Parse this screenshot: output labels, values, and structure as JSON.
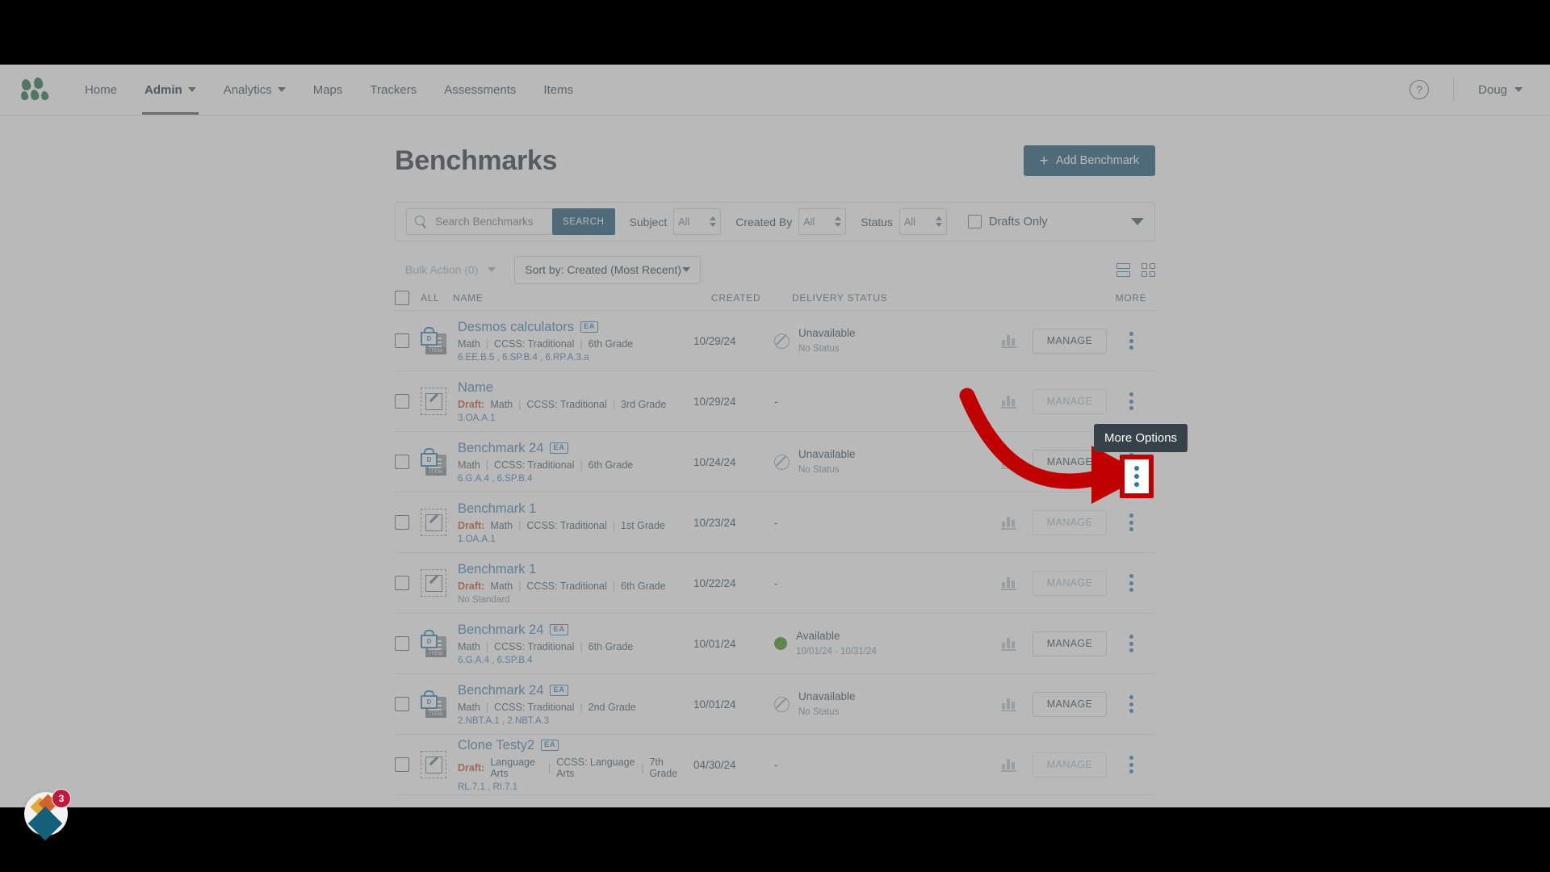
{
  "nav": {
    "logo_icon": "three-leaf-logo",
    "items": [
      {
        "label": "Home",
        "has_caret": false,
        "active": false
      },
      {
        "label": "Admin",
        "has_caret": true,
        "active": true
      },
      {
        "label": "Analytics",
        "has_caret": true,
        "active": false
      },
      {
        "label": "Maps",
        "has_caret": false,
        "active": false
      },
      {
        "label": "Trackers",
        "has_caret": false,
        "active": false
      },
      {
        "label": "Assessments",
        "has_caret": false,
        "active": false
      },
      {
        "label": "Items",
        "has_caret": false,
        "active": false
      }
    ],
    "help_icon": "question-mark-circle-icon",
    "user_label": "Doug"
  },
  "header": {
    "title": "Benchmarks",
    "add_button": "Add Benchmark",
    "add_button_icon": "plus-icon",
    "add_button_color": "#145374"
  },
  "filters": {
    "search_placeholder": "Search Benchmarks",
    "search_value": "",
    "search_icon": "search-icon",
    "search_button": "SEARCH",
    "subject_label": "Subject",
    "subject_value": "All",
    "created_by_label": "Created By",
    "created_by_value": "All",
    "status_label": "Status",
    "status_value": "All",
    "drafts_only_label": "Drafts Only",
    "drafts_only_checked": false,
    "expand_icon": "chevron-down-icon"
  },
  "actions": {
    "bulk_action_label": "Bulk Action (0)",
    "sort_label": "Sort by: Created (Most Recent)",
    "list_view_icon": "list-view-icon",
    "grid_view_icon": "grid-view-icon",
    "active_view": "list"
  },
  "table": {
    "headers": {
      "all": "ALL",
      "name": "NAME",
      "created": "CREATED",
      "delivery_status": "DELIVERY STATUS",
      "more": "MORE"
    },
    "manage_label": "MANAGE",
    "rows": [
      {
        "icon": "locked-item-icon",
        "title": "Desmos calculators",
        "badge": "EA",
        "draft": false,
        "draft_label": "",
        "subject": "Math",
        "framework": "CCSS: Traditional",
        "grade": "6th Grade",
        "standards": "6.EE.B.5 , 6.SP.B.4 , 6.RP.A.3.a",
        "created": "10/29/24",
        "status": "Unavailable",
        "status_sub": "No Status",
        "status_type": "unavailable",
        "manage_enabled": true
      },
      {
        "icon": "draft-pencil-icon",
        "title": "Name",
        "badge": "",
        "draft": true,
        "draft_label": "Draft:",
        "subject": "Math",
        "framework": "CCSS: Traditional",
        "grade": "3rd Grade",
        "standards": "3.OA.A.1",
        "created": "10/29/24",
        "status": "-",
        "status_sub": "",
        "status_type": "none",
        "manage_enabled": false
      },
      {
        "icon": "locked-item-icon",
        "title": "Benchmark 24",
        "badge": "EA",
        "draft": false,
        "draft_label": "",
        "subject": "Math",
        "framework": "CCSS: Traditional",
        "grade": "6th Grade",
        "standards": "6.G.A.4 , 6.SP.B.4",
        "created": "10/24/24",
        "status": "Unavailable",
        "status_sub": "No Status",
        "status_type": "unavailable",
        "manage_enabled": true
      },
      {
        "icon": "draft-pencil-icon",
        "title": "Benchmark 1",
        "badge": "",
        "draft": true,
        "draft_label": "Draft:",
        "subject": "Math",
        "framework": "CCSS: Traditional",
        "grade": "1st Grade",
        "standards": "1.OA.A.1",
        "created": "10/23/24",
        "status": "-",
        "status_sub": "",
        "status_type": "none",
        "manage_enabled": false
      },
      {
        "icon": "draft-pencil-icon",
        "title": "Benchmark 1",
        "badge": "",
        "draft": true,
        "draft_label": "Draft:",
        "subject": "Math",
        "framework": "CCSS: Traditional",
        "grade": "6th Grade",
        "standards": "No Standard",
        "created": "10/22/24",
        "status": "-",
        "status_sub": "",
        "status_type": "none",
        "manage_enabled": false
      },
      {
        "icon": "locked-item-icon",
        "title": "Benchmark 24",
        "badge": "EA",
        "draft": false,
        "draft_label": "",
        "subject": "Math",
        "framework": "CCSS: Traditional",
        "grade": "6th Grade",
        "standards": "6.G.A.4 , 6.SP.B.4",
        "created": "10/01/24",
        "status": "Available",
        "status_sub": "10/01/24 - 10/31/24",
        "status_type": "available",
        "manage_enabled": true
      },
      {
        "icon": "locked-item-icon",
        "title": "Benchmark 24",
        "badge": "EA",
        "draft": false,
        "draft_label": "",
        "subject": "Math",
        "framework": "CCSS: Traditional",
        "grade": "2nd Grade",
        "standards": "2.NBT.A.1 , 2.NBT.A.3",
        "created": "10/01/24",
        "status": "Unavailable",
        "status_sub": "No Status",
        "status_type": "unavailable",
        "manage_enabled": true
      },
      {
        "icon": "draft-pencil-icon",
        "title": "Clone Testy2",
        "badge": "EA",
        "draft": true,
        "draft_label": "Draft:",
        "subject": "Language Arts",
        "framework": "CCSS: Language Arts",
        "grade": "7th Grade",
        "standards": "RL.7.1 , RI.7.1",
        "created": "04/30/24",
        "status": "-",
        "status_sub": "",
        "status_type": "none",
        "manage_enabled": false
      }
    ]
  },
  "annotation": {
    "tooltip_text": "More Options",
    "highlight_color": "#c00000",
    "arrow_icon": "curved-arrow-right-icon"
  },
  "fab": {
    "badge_count": "3",
    "icon": "diamond-stack-icon"
  }
}
